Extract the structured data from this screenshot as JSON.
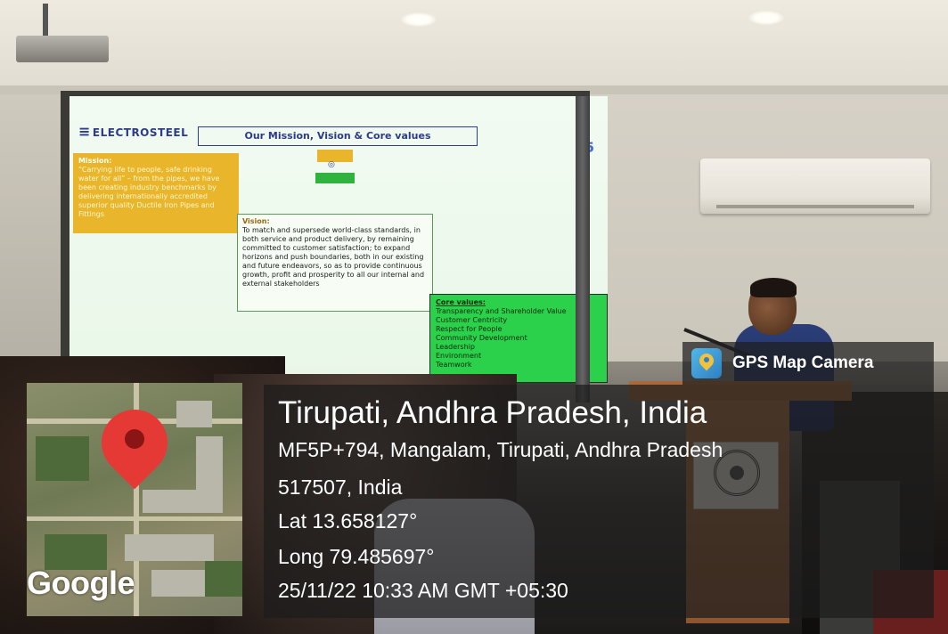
{
  "slide": {
    "logo": "ELECTROSTEEL",
    "title": "Our Mission, Vision & Core values",
    "slide_number": "5",
    "mission_heading": "Mission:",
    "mission_text": "“Carrying life to people, safe drinking water for all” – from the pipes, we have been creating industry benchmarks by delivering internationally accredited superior quality Ductile Iron Pipes and Fittings",
    "vision_heading": "Vision:",
    "vision_text": "To match and supersede world-class standards, in both service and product delivery, by remaining committed to customer satisfaction; to expand horizons and push boundaries, both in our existing and future endeavors, so as to provide continuous growth, profit and prosperity to all our internal and external stakeholders",
    "core_heading": "Core values:",
    "core_values": [
      "Transparency and Shareholder Value",
      "Customer Centricity",
      "Respect for People",
      "Community Development",
      "Leadership",
      "Environment",
      "Teamwork"
    ]
  },
  "overlay": {
    "app_name": "GPS Map Camera",
    "place_title": "Tirupati, Andhra Pradesh, India",
    "address_line1": "MF5P+794, Mangalam, Tirupati, Andhra Pradesh",
    "address_line2": "517507, India",
    "latitude": "Lat 13.658127°",
    "longitude": "Long 79.485697°",
    "timestamp": "25/11/22 10:33 AM GMT +05:30",
    "map_brand": "Google"
  },
  "icons": {
    "app_icon": "gps-map-camera-icon",
    "map_marker": "map-pin-icon"
  },
  "colors": {
    "pin_red": "#e53935",
    "overlay_bg": "rgba(28,28,28,0.72)",
    "mission_yellow": "#e9b52a",
    "core_green": "#2bd04b"
  }
}
